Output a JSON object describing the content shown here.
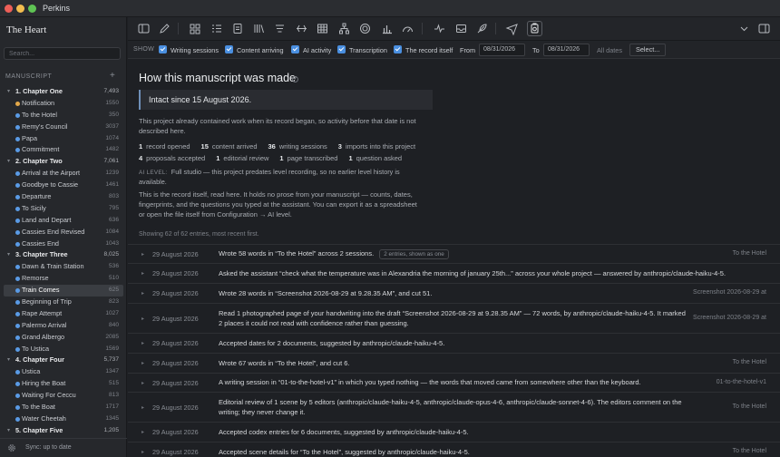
{
  "window": {
    "title": "Perkins"
  },
  "sidebar": {
    "project_title": "The Heart",
    "search_placeholder": "Search...",
    "section_label": "MANUSCRIPT",
    "add_symbol": "+",
    "items": [
      {
        "kind": "chapter",
        "label": "1. Chapter One",
        "count": "7,493"
      },
      {
        "kind": "scene",
        "label": "Notification",
        "count": "1550",
        "dot": "#e2a84a"
      },
      {
        "kind": "scene",
        "label": "To the Hotel",
        "count": "350",
        "dot": "#5a9be6"
      },
      {
        "kind": "scene",
        "label": "Remy's Council",
        "count": "3037",
        "dot": "#5a9be6"
      },
      {
        "kind": "scene",
        "label": "Papa",
        "count": "1074",
        "dot": "#5a9be6"
      },
      {
        "kind": "scene",
        "label": "Commitment",
        "count": "1482",
        "dot": "#5a9be6"
      },
      {
        "kind": "chapter",
        "label": "2. Chapter Two",
        "count": "7,061"
      },
      {
        "kind": "scene",
        "label": "Arrival at the Airport",
        "count": "1239",
        "dot": "#5a9be6"
      },
      {
        "kind": "scene",
        "label": "Goodbye to Cassie",
        "count": "1461",
        "dot": "#5a9be6"
      },
      {
        "kind": "scene",
        "label": "Departure",
        "count": "803",
        "dot": "#5a9be6"
      },
      {
        "kind": "scene",
        "label": "To Sicily",
        "count": "795",
        "dot": "#5a9be6"
      },
      {
        "kind": "scene",
        "label": "Land and Depart",
        "count": "636",
        "dot": "#5a9be6"
      },
      {
        "kind": "scene",
        "label": "Cassies End Revised",
        "count": "1084",
        "dot": "#5a9be6"
      },
      {
        "kind": "scene",
        "label": "Cassies End",
        "count": "1043",
        "dot": "#5a9be6"
      },
      {
        "kind": "chapter",
        "label": "3. Chapter Three",
        "count": "8,025"
      },
      {
        "kind": "scene",
        "label": "Dawn & Train Station",
        "count": "536",
        "dot": "#5a9be6"
      },
      {
        "kind": "scene",
        "label": "Remorse",
        "count": "510",
        "dot": "#5a9be6"
      },
      {
        "kind": "scene",
        "label": "Train Comes",
        "count": "625",
        "dot": "#5a9be6",
        "selected": true
      },
      {
        "kind": "scene",
        "label": "Beginning of Trip",
        "count": "823",
        "dot": "#5a9be6"
      },
      {
        "kind": "scene",
        "label": "Rape Attempt",
        "count": "1027",
        "dot": "#5a9be6"
      },
      {
        "kind": "scene",
        "label": "Palermo Arrival",
        "count": "840",
        "dot": "#5a9be6"
      },
      {
        "kind": "scene",
        "label": "Grand Albergo",
        "count": "2085",
        "dot": "#5a9be6"
      },
      {
        "kind": "scene",
        "label": "To Ustica",
        "count": "1569",
        "dot": "#5a9be6"
      },
      {
        "kind": "chapter",
        "label": "4. Chapter Four",
        "count": "5,737"
      },
      {
        "kind": "scene",
        "label": "Ustica",
        "count": "1347",
        "dot": "#5a9be6"
      },
      {
        "kind": "scene",
        "label": "Hiring the Boat",
        "count": "515",
        "dot": "#5a9be6"
      },
      {
        "kind": "scene",
        "label": "Waiting For Ceccu",
        "count": "813",
        "dot": "#5a9be6"
      },
      {
        "kind": "scene",
        "label": "To the Boat",
        "count": "1717",
        "dot": "#5a9be6"
      },
      {
        "kind": "scene",
        "label": "Water Cheetah",
        "count": "1345",
        "dot": "#5a9be6"
      },
      {
        "kind": "chapter",
        "label": "5. Chapter Five",
        "count": "1,205"
      }
    ],
    "footer_status": "Sync: up to date"
  },
  "filters": {
    "show_label": "SHOW",
    "options": [
      "Writing sessions",
      "Content arriving",
      "AI activity",
      "Transcription",
      "The record itself"
    ],
    "from_label": "From",
    "from_date": "08/31/2026",
    "to_label": "To",
    "to_date": "08/31/2026",
    "all_dates_label": "All dates",
    "select_label": "Select..."
  },
  "record": {
    "heading": "How this manuscript was made",
    "info_glyph": "?",
    "intact_since": "Intact since 15 August 2026.",
    "pre_note": "This project already contained work when its record began, so activity before that date is not described here.",
    "stats_line1": [
      {
        "n": "1",
        "label": "record opened"
      },
      {
        "n": "15",
        "label": "content arrived"
      },
      {
        "n": "36",
        "label": "writing sessions"
      },
      {
        "n": "3",
        "label": "imports into this project"
      }
    ],
    "stats_line2": [
      {
        "n": "4",
        "label": "proposals accepted"
      },
      {
        "n": "1",
        "label": "editorial review"
      },
      {
        "n": "1",
        "label": "page transcribed"
      },
      {
        "n": "1",
        "label": "question asked"
      }
    ],
    "ai_level_key": "AI LEVEL:",
    "ai_level_value": "Full studio — this project predates level recording, so no earlier level history is available.",
    "about": "This is the record itself, read here. It holds no prose from your manuscript — counts, dates, fingerprints, and the questions you typed at the assistant. You can export it as a spreadsheet or open the file itself from Configuration → AI level.",
    "showing": "Showing 62 of 62 entries, most recent first."
  },
  "log": [
    {
      "date": "29 August 2026",
      "text": "Wrote 58 words in “To the Hotel” across 2 sessions.",
      "tag": "2 entries, shown as one",
      "doc": "To the Hotel",
      "h": 21
    },
    {
      "date": "29 August 2026",
      "text": "Asked the assistant “check what the temperature was in Alexandria the morning of january 25th...” across your whole project — answered by anthropic/claude-haiku-4-5.",
      "tag": "",
      "doc": "",
      "h": 22,
      "wide": true
    },
    {
      "date": "29 August 2026",
      "text": "Wrote 28 words in “Screenshot 2026-08-29 at 9.28.35 AM”, and cut 51.",
      "tag": "",
      "doc": "Screenshot 2026-08-29 at",
      "h": 22
    },
    {
      "date": "29 August 2026",
      "text": "Read 1 photographed page of your handwriting into the draft “Screenshot 2026-08-29 at 9.28.35 AM” — 72 words, by anthropic/claude-haiku-4-5. It marked 2 places it could not read with confidence rather than guessing.",
      "tag": "",
      "doc": "Screenshot 2026-08-29 at",
      "h": 33
    },
    {
      "date": "29 August 2026",
      "text": "Accepted dates for 2 documents, suggested by anthropic/claude-haiku-4-5.",
      "tag": "",
      "doc": "",
      "h": 22
    },
    {
      "date": "29 August 2026",
      "text": "Wrote 67 words in “To the Hotel”, and cut 6.",
      "tag": "",
      "doc": "To the Hotel",
      "h": 22
    },
    {
      "date": "29 August 2026",
      "text": "A writing session in “01-to-the-hotel-v1” in which you typed nothing — the words that moved came from somewhere other than the keyboard.",
      "tag": "",
      "doc": "01-to-the-hotel-v1",
      "h": 21
    },
    {
      "date": "29 August 2026",
      "text": "Editorial review of 1 scene by 5 editors (anthropic/claude-haiku-4-5, anthropic/claude-opus-4-6, anthropic/claude-sonnet-4-6). The editors comment on the writing; they never change it.",
      "tag": "",
      "doc": "To the Hotel",
      "h": 33
    },
    {
      "date": "29 August 2026",
      "text": "Accepted codex entries for 6 documents, suggested by anthropic/claude-haiku-4-5.",
      "tag": "",
      "doc": "",
      "h": 22
    },
    {
      "date": "29 August 2026",
      "text": "Accepted scene details for “To the Hotel”, suggested by anthropic/claude-haiku-4-5.",
      "tag": "",
      "doc": "To the Hotel",
      "h": 22
    }
  ],
  "colors": {
    "accent": "#4a8fe0",
    "close": "#ee5f58",
    "minimize": "#f3bd4f",
    "zoom": "#5fc454"
  }
}
